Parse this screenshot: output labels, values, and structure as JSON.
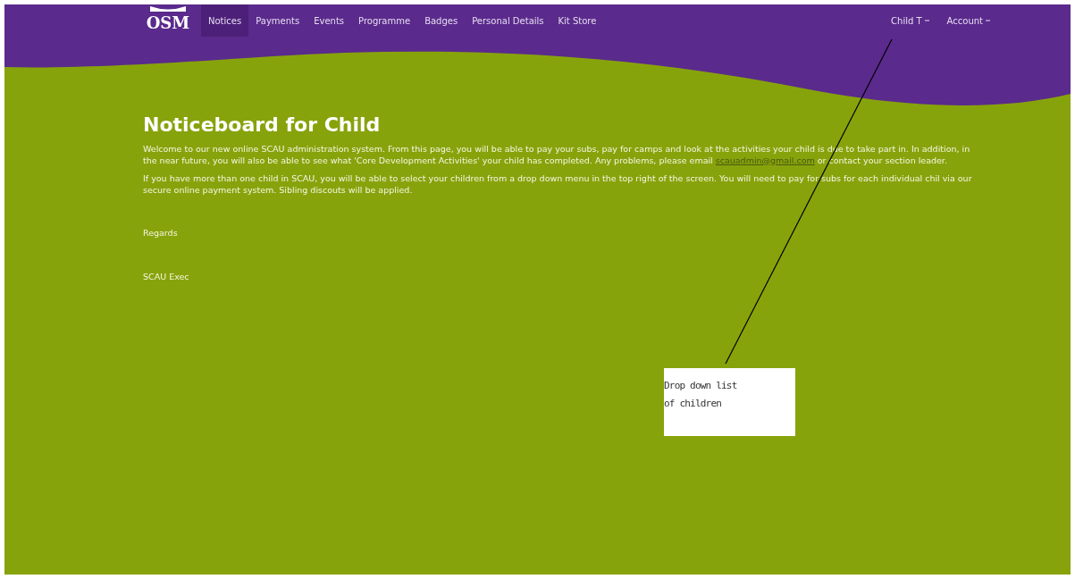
{
  "nav": {
    "logo": "OSM",
    "items": [
      {
        "label": "Notices",
        "selected": true
      },
      {
        "label": "Payments",
        "selected": false
      },
      {
        "label": "Events",
        "selected": false
      },
      {
        "label": "Programme",
        "selected": false
      },
      {
        "label": "Badges",
        "selected": false
      },
      {
        "label": "Personal Details",
        "selected": false
      },
      {
        "label": "Kit Store",
        "selected": false
      }
    ],
    "right_menus": [
      "Child T",
      "Account"
    ]
  },
  "title": "Noticeboard for Child",
  "intro": {
    "before": "Welcome to our new online SCAU administration system.  From this page, you will be able to pay your subs, pay for camps and look at the activities your child is due to take part in. In addition, in the near future, you will also be able to see what 'Core Development Activities' your child has completed.  Any problems, please email ",
    "link": "scauadmin@gmail.com",
    "after": " or contact your section leader."
  },
  "paragraphs": [
    "If you have more than one child in SCAU, you will be able to select your children from a drop down menu in the top right of the screen.  You will need to pay for subs for each individual chil via our secure online payment system. Sibling discouts will be applied.",
    "Regards",
    "SCAU Exec"
  ],
  "callout": {
    "lines": [
      "Drop down list",
      "of children"
    ]
  }
}
